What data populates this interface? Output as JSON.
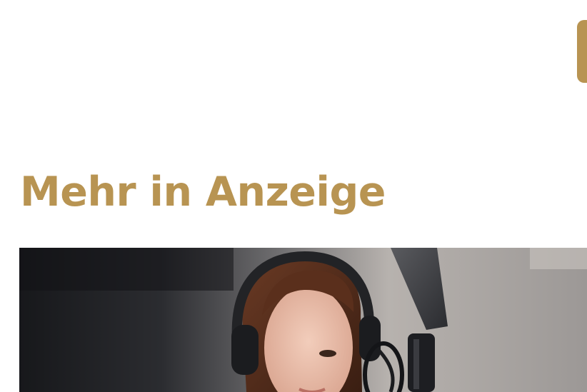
{
  "header": {
    "edge_button_color": "#b89452"
  },
  "section": {
    "title": "Mehr in Anzeige",
    "accent_color": "#b89452"
  },
  "teaser": {
    "image_icon": "photo-woman-headphones-microphone"
  }
}
